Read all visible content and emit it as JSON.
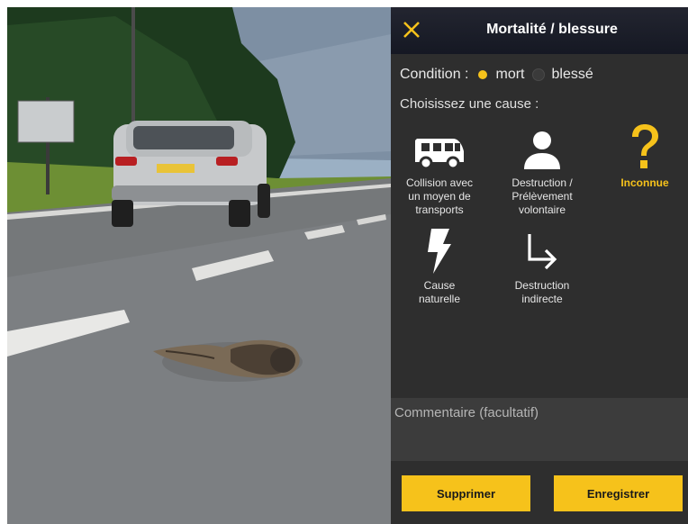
{
  "header": {
    "title": "Mortalité / blessure",
    "close_icon": "close-icon"
  },
  "condition": {
    "label": "Condition :",
    "options": [
      {
        "label": "mort",
        "selected": true
      },
      {
        "label": "blessé",
        "selected": false
      }
    ]
  },
  "cause_prompt": "Choisissez une cause :",
  "causes": [
    {
      "icon": "bus-icon",
      "label": "Collision avec\nun moyen de\ntransports",
      "selected": false
    },
    {
      "icon": "person-icon",
      "label": "Destruction /\nPrélèvement\nvolontaire",
      "selected": false
    },
    {
      "icon": "question-icon",
      "label": "Inconnue",
      "selected": true
    },
    {
      "icon": "lightning-icon",
      "label": "Cause\nnaturelle",
      "selected": false
    },
    {
      "icon": "turn-arrow-icon",
      "label": "Destruction\nindirecte",
      "selected": false
    }
  ],
  "comment": {
    "placeholder": "Commentaire (facultatif)",
    "value": ""
  },
  "buttons": {
    "delete_label": "Supprimer",
    "save_label": "Enregistrer"
  },
  "colors": {
    "accent": "#f6c21b",
    "panel_bg": "#2e2e2e",
    "header_bg": "#1c1f2a"
  }
}
